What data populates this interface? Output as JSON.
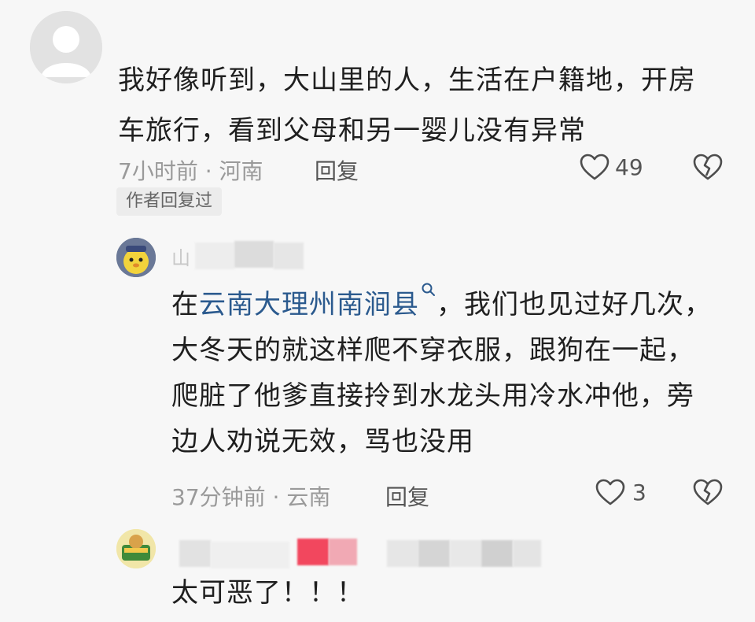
{
  "comments": [
    {
      "text": "我好像听到，大山里的人，生活在户籍地，开房车旅行，看到父母和另一婴儿没有异常",
      "meta": "7小时前 · 河南",
      "reply_label": "回复",
      "likes": "49",
      "badge": "作者回复过"
    },
    {
      "name_partial": "山",
      "text_before": "在",
      "link_text": "云南大理州南涧县",
      "text_after": "，我们也见过好几次，大冬天的就这样爬不穿衣服，跟狗在一起，爬脏了他爹直接拎到水龙头用冷水冲他，旁边人劝说无效，骂也没用",
      "meta": "37分钟前 · 云南",
      "reply_label": "回复",
      "likes": "3"
    },
    {
      "text": "太可恶了！！！"
    }
  ],
  "colors": {
    "link": "#2b5a8e",
    "meta": "#9a9a9a"
  },
  "icons": [
    "default-avatar-icon",
    "heart-icon",
    "broken-heart-icon",
    "search-icon"
  ]
}
